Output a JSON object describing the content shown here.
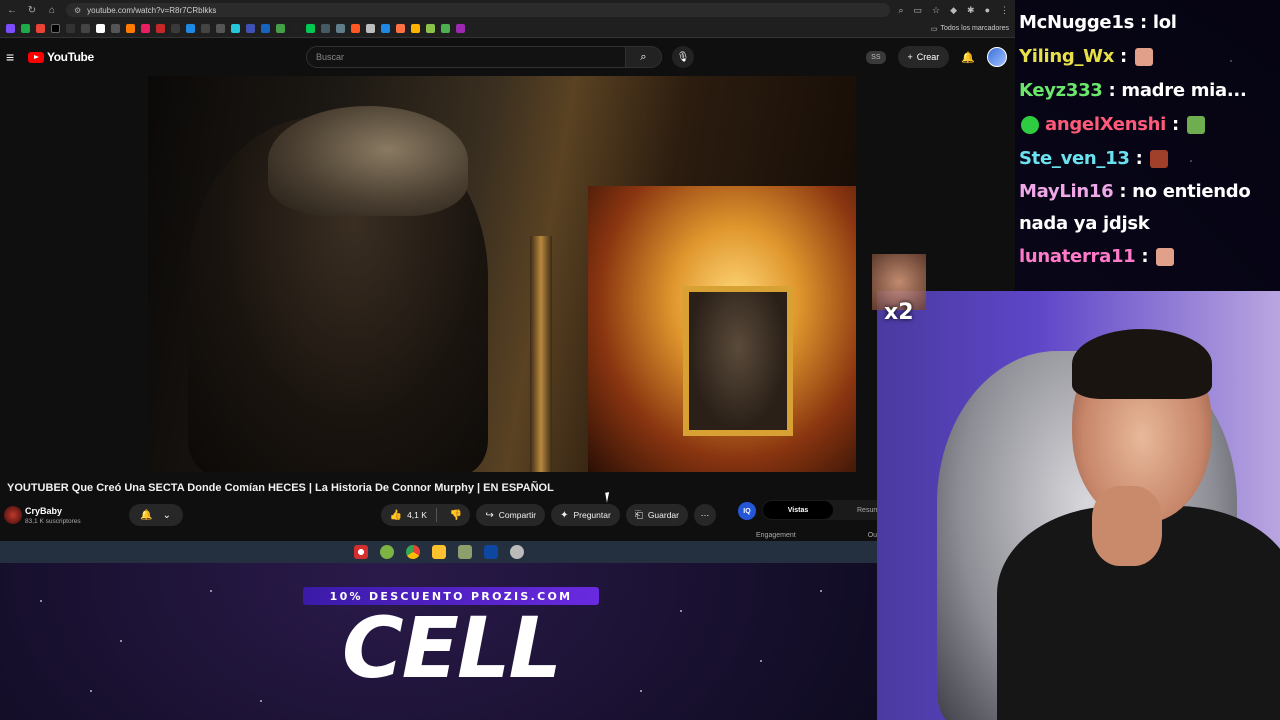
{
  "browser": {
    "url": "youtube.com/watch?v=R8r7CRblkks",
    "bookmarks_all": "Todos los marcadores"
  },
  "youtube": {
    "logo": "YouTube",
    "search_placeholder": "Buscar",
    "ss_badge": "SS",
    "create_label": "Crear"
  },
  "video": {
    "title": "YOUTUBER Que Creó Una SECTA Donde Comían HECES | La Historia De Connor Murphy | EN ESPAÑOL",
    "channel_name": "CryBaby",
    "subscribers": "83,1 K suscriptores",
    "likes": "4,1 K",
    "share_label": "Compartir",
    "ask_label": "Preguntar",
    "save_label": "Guardar"
  },
  "side_panel": {
    "icon_text": "IQ",
    "tab_active": "Vistas",
    "tab_other": "Resum",
    "label_left": "Engagement",
    "label_right": "Outlie"
  },
  "chat": {
    "messages": [
      {
        "user": "McNugge1s",
        "text": ": lol",
        "color": "#ffffff"
      },
      {
        "user": "Yiling_Wx",
        "text": ":",
        "color": "#e8e04a"
      },
      {
        "user": "Keyz333",
        "text": ": madre mia...",
        "color": "#6be86b"
      },
      {
        "user": "angelXenshi",
        "text": ":",
        "color": "#ff5a7a"
      },
      {
        "user": "Ste_ven_13",
        "text": ":",
        "color": "#6ae3f0"
      },
      {
        "user": "MayLin16",
        "text": ": no entiendo nada ya jdjsk",
        "color": "#f0a8e8"
      },
      {
        "user": "lunaterra11",
        "text": ":",
        "color": "#ff7ac8"
      }
    ]
  },
  "overlay": {
    "multiplier": "x2",
    "sponsor_banner": "10% DESCUENTO PROZIS.COM",
    "sponsor_word": "CELL"
  }
}
